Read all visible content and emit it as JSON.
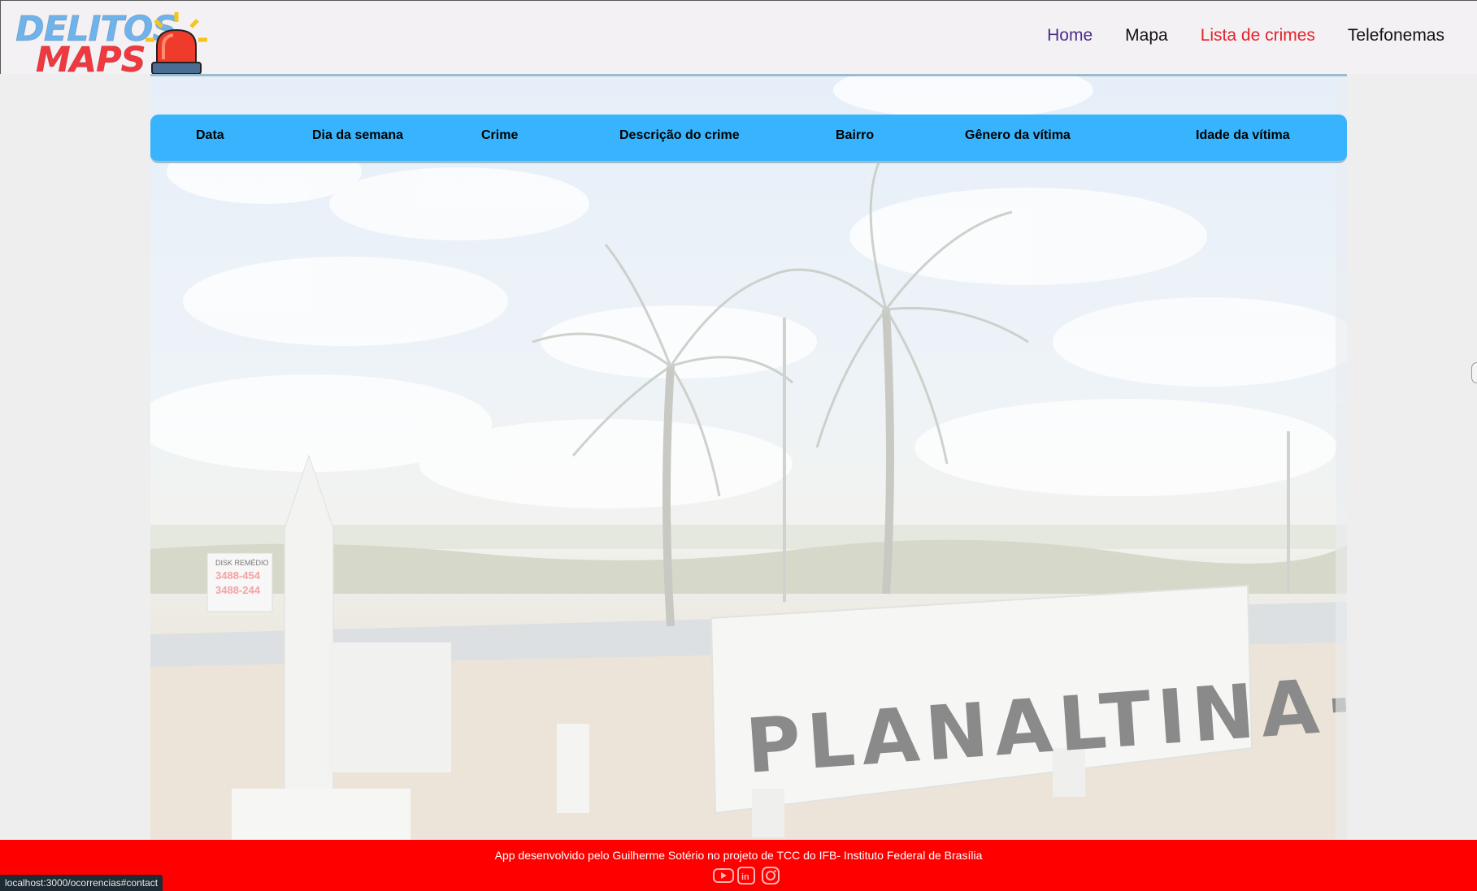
{
  "logo": {
    "line1": "DELITOS",
    "line2": "MAPS",
    "icon": "siren-icon"
  },
  "nav": {
    "home": "Home",
    "map": "Mapa",
    "crimes": "Lista de crimes",
    "phones": "Telefonemas"
  },
  "table": {
    "columns": [
      "Data",
      "Dia da semana",
      "Crime",
      "Descrição do crime",
      "Bairro",
      "Gênero da vítima",
      "Idade da vítima"
    ]
  },
  "background": {
    "sign_text": "PLANALTINA·DF",
    "billboard_line1": "DISK REMÉDIO",
    "billboard_line2": "3488-454",
    "billboard_line3": "3488-244"
  },
  "footer": {
    "text": "App desenvolvido pelo Guilherme Sotério no projeto de TCC do IFB- Instituto Federal de Brasília",
    "icons": [
      "youtube-icon",
      "linkedin-icon",
      "instagram-icon"
    ]
  },
  "status_bar": {
    "url": "localhost:3000/ocorrencias#contact"
  },
  "colors": {
    "header_bg": "#f4f1f4",
    "table_head": "#37b4fd",
    "footer_bg": "#ff0000",
    "nav_active": "#e4222a",
    "nav_home": "#4b2d86"
  }
}
